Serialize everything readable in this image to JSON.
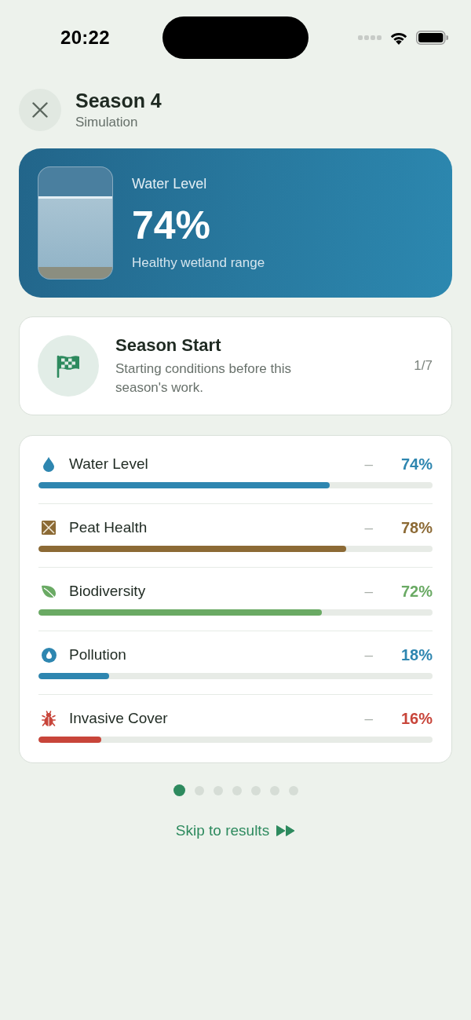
{
  "status_bar": {
    "time": "20:22"
  },
  "header": {
    "title": "Season 4",
    "subtitle": "Simulation"
  },
  "hero": {
    "label": "Water Level",
    "value": "74%",
    "caption": "Healthy wetland range",
    "level": 0.74
  },
  "event": {
    "title": "Season Start",
    "description": "Starting conditions before this season's work.",
    "counter": "1/7"
  },
  "metrics": [
    {
      "name": "Water Level",
      "change": "–",
      "value": "74%",
      "level": 0.74,
      "color": "#2e86b0"
    },
    {
      "name": "Peat Health",
      "change": "–",
      "value": "78%",
      "level": 0.78,
      "color": "#8c6a35"
    },
    {
      "name": "Biodiversity",
      "change": "–",
      "value": "72%",
      "level": 0.72,
      "color": "#6aaa64"
    },
    {
      "name": "Pollution",
      "change": "–",
      "value": "18%",
      "level": 0.18,
      "color": "#2e86b0"
    },
    {
      "name": "Invasive Cover",
      "change": "–",
      "value": "16%",
      "level": 0.16,
      "color": "#c8453a"
    }
  ],
  "pager": [
    {
      "selected": true
    },
    {
      "selected": false
    },
    {
      "selected": false
    },
    {
      "selected": false
    },
    {
      "selected": false
    },
    {
      "selected": false
    },
    {
      "selected": false
    }
  ],
  "skip_link": {
    "label": "Skip to results"
  }
}
